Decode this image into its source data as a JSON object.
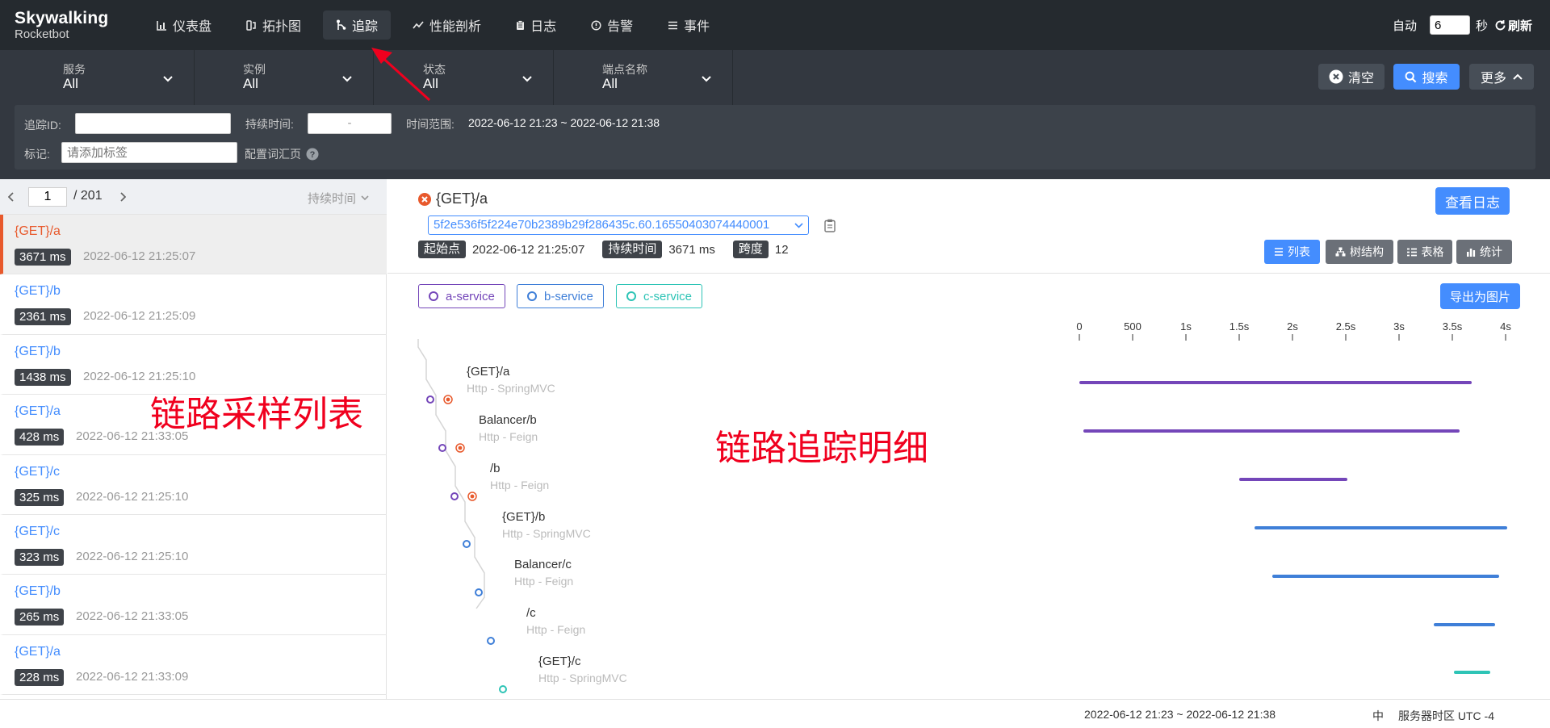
{
  "app": {
    "logo_main": "Skywalking",
    "logo_sub": "Rocketbot"
  },
  "nav": [
    {
      "label": "仪表盘",
      "icon": "chart-bar-icon",
      "active": false
    },
    {
      "label": "拓扑图",
      "icon": "topology-icon",
      "active": false
    },
    {
      "label": "追踪",
      "icon": "trace-icon",
      "active": true
    },
    {
      "label": "性能剖析",
      "icon": "trend-icon",
      "active": false
    },
    {
      "label": "日志",
      "icon": "clipboard-icon",
      "active": false
    },
    {
      "label": "告警",
      "icon": "alarm-icon",
      "active": false
    },
    {
      "label": "事件",
      "icon": "list-icon",
      "active": false
    }
  ],
  "auto_refresh": {
    "label": "自动",
    "value": "6",
    "unit": "秒",
    "refresh_label": "刷新"
  },
  "filters": [
    {
      "label": "服务",
      "value": "All"
    },
    {
      "label": "实例",
      "value": "All"
    },
    {
      "label": "状态",
      "value": "All"
    },
    {
      "label": "端点名称",
      "value": "All"
    }
  ],
  "actions": {
    "clear": "清空",
    "search": "搜索",
    "more": "更多"
  },
  "search": {
    "trace_id_label": "追踪ID:",
    "trace_id_value": "",
    "duration_label": "持续时间:",
    "duration_sep": "-",
    "time_range_label": "时间范围:",
    "time_range_value": "2022-06-12 21:23 ~ 2022-06-12 21:38",
    "tag_label": "标记:",
    "tag_placeholder": "请添加标签",
    "vocab_link": "配置词汇页"
  },
  "list": {
    "page": "1",
    "total": "/ 201",
    "sort_label": "持续时间",
    "items": [
      {
        "endpoint": "{GET}/a",
        "duration": "3671 ms",
        "time": "2022-06-12 21:25:07"
      },
      {
        "endpoint": "{GET}/b",
        "duration": "2361 ms",
        "time": "2022-06-12 21:25:09"
      },
      {
        "endpoint": "{GET}/b",
        "duration": "1438 ms",
        "time": "2022-06-12 21:25:10"
      },
      {
        "endpoint": "{GET}/a",
        "duration": "428 ms",
        "time": "2022-06-12 21:33:05"
      },
      {
        "endpoint": "{GET}/c",
        "duration": "325 ms",
        "time": "2022-06-12 21:25:10"
      },
      {
        "endpoint": "{GET}/c",
        "duration": "323 ms",
        "time": "2022-06-12 21:25:10"
      },
      {
        "endpoint": "{GET}/b",
        "duration": "265 ms",
        "time": "2022-06-12 21:33:05"
      },
      {
        "endpoint": "{GET}/a",
        "duration": "228 ms",
        "time": "2022-06-12 21:33:09"
      }
    ]
  },
  "annotations": {
    "list": "链路采样列表",
    "detail": "链路追踪明细"
  },
  "detail": {
    "title": "{GET}/a",
    "trace_id": "5f2e536f5f224e70b2389b29f286435c.60.16550403074440001",
    "start_label": "起始点",
    "start_value": "2022-06-12 21:25:07",
    "duration_label": "持续时间",
    "duration_value": "3671 ms",
    "span_label": "跨度",
    "span_value": "12",
    "view_logs": "查看日志",
    "views": [
      "列表",
      "树结构",
      "表格",
      "统计"
    ],
    "export": "导出为图片",
    "services": [
      {
        "name": "a-service",
        "color": "#7446b9"
      },
      {
        "name": "b-service",
        "color": "#3f7fd8"
      },
      {
        "name": "c-service",
        "color": "#2ec4b6"
      }
    ],
    "axis": [
      "0",
      "500",
      "1s",
      "1.5s",
      "2s",
      "2.5s",
      "3s",
      "3.5s",
      "4s"
    ],
    "spans": [
      {
        "name": "{GET}/a",
        "sub": "Http - SpringMVC",
        "service": 0
      },
      {
        "name": "Balancer/b",
        "sub": "Http - Feign",
        "service": 0
      },
      {
        "name": "/b",
        "sub": "Http - Feign",
        "service": 0
      },
      {
        "name": "{GET}/b",
        "sub": "Http - SpringMVC",
        "service": 1
      },
      {
        "name": "Balancer/c",
        "sub": "Http - Feign",
        "service": 1
      },
      {
        "name": "/c",
        "sub": "Http - Feign",
        "service": 1
      },
      {
        "name": "{GET}/c",
        "sub": "Http - SpringMVC",
        "service": 2
      }
    ]
  },
  "footer": {
    "range": "2022-06-12 21:23 ~ 2022-06-12 21:38",
    "lang": "中",
    "tz": "服务器时区 UTC -4"
  }
}
